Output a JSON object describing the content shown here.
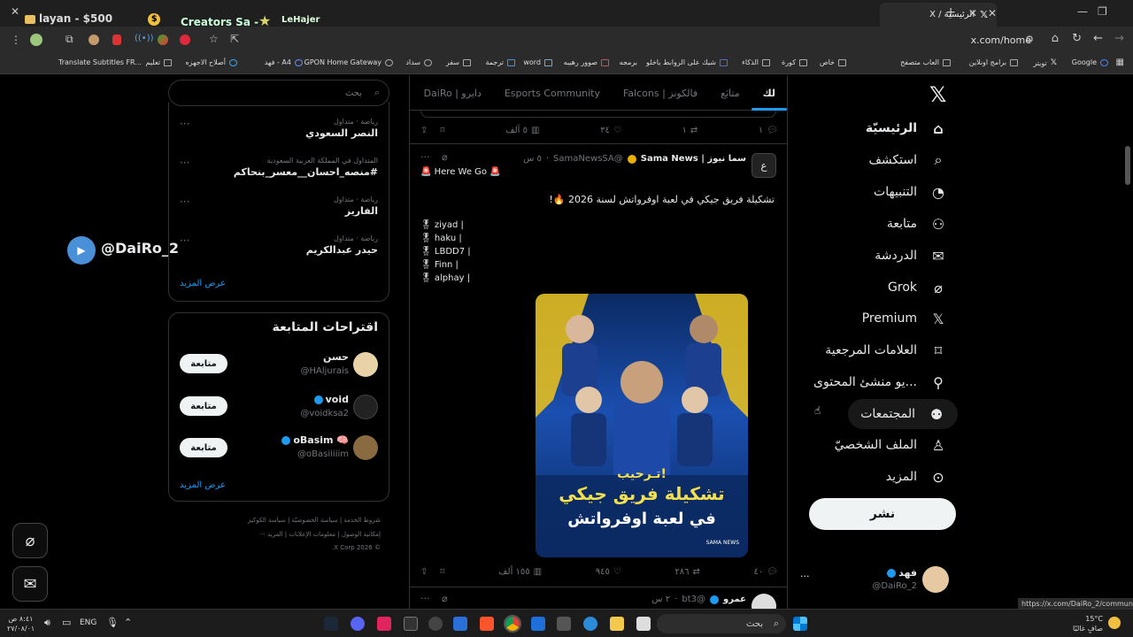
{
  "browser": {
    "tab_title": "الرئيسية / X",
    "url": "x.com/home",
    "overlay_text": "layan - $500",
    "overlay_text2": "Creators Sa -",
    "overlay_text3": "LeHajer",
    "bookmarks": [
      {
        "label": "Google",
        "icon": "google-icon"
      },
      {
        "label": "تويتر",
        "icon": "x-icon"
      },
      {
        "label": "برامج اونلاين",
        "icon": "folder-icon"
      },
      {
        "label": "العاب متصفح",
        "icon": "folder-icon"
      },
      {
        "label": "خاص",
        "icon": "folder-icon"
      },
      {
        "label": "كورة",
        "icon": "folder-icon"
      },
      {
        "label": "الذكاء",
        "icon": "folder-icon"
      },
      {
        "label": "شيك على الروابط ياخلو",
        "icon": "site-icon"
      },
      {
        "label": "برمجه",
        "icon": "site-icon"
      },
      {
        "label": "صوور رهيبه",
        "icon": "site-icon"
      },
      {
        "label": "word",
        "icon": "word-icon"
      },
      {
        "label": "ترجمة",
        "icon": "translate-icon"
      },
      {
        "label": "سفر",
        "icon": "folder-icon"
      },
      {
        "label": "سداد",
        "icon": "site-icon"
      },
      {
        "label": "GPON Home Gateway",
        "icon": "globe-icon"
      },
      {
        "label": "فهد - A4",
        "icon": "site-icon"
      },
      {
        "label": "أصلاح الاجهزه",
        "icon": "site-icon"
      },
      {
        "label": "تعليم",
        "icon": "folder-icon"
      },
      {
        "label": "Translate Subtitles FR...",
        "icon": "site-icon"
      }
    ]
  },
  "nav": {
    "items": [
      {
        "label": "الرئيسيّة",
        "icon": "home-icon"
      },
      {
        "label": "استكشف",
        "icon": "search-icon"
      },
      {
        "label": "التنبيهات",
        "icon": "bell-icon"
      },
      {
        "label": "متابعة",
        "icon": "person-plus-icon"
      },
      {
        "label": "الدردشة",
        "icon": "mail-icon"
      },
      {
        "label": "Grok",
        "icon": "grok-icon"
      },
      {
        "label": "Premium",
        "icon": "x-icon"
      },
      {
        "label": "العلامات المرجعية",
        "icon": "bookmark-icon"
      },
      {
        "label": "...يو منشئ المحتوى",
        "icon": "creator-icon"
      },
      {
        "label": "المجتمعات",
        "icon": "communities-icon"
      },
      {
        "label": "الملف الشخصيّ",
        "icon": "person-icon"
      },
      {
        "label": "المزيد",
        "icon": "more-icon"
      }
    ],
    "post_button": "نشر",
    "profile": {
      "name": "فهد",
      "handle": "@DaiRo_2"
    }
  },
  "timeline": {
    "tabs": [
      "لك",
      "متابَع",
      "فالكونز | Falcons",
      "Esports Community",
      "دايرو | DaiRo"
    ],
    "first_actions": {
      "replies": "١",
      "reposts": "١",
      "likes": "٣٤",
      "views": "٥ آلف"
    },
    "tweet": {
      "author_name": "سما نيوز | Sama News",
      "author_handle": "@SamaNewsSA",
      "time": "٥ س",
      "line1": "🚨 Here We Go 🚨",
      "line2": "تشكيلة فريق جيكي في لعبة اوفرواتش لسنة 2026 🔥!",
      "roster": [
        "ziyad |",
        "haku |",
        "LBDD7 |",
        "Finn |",
        "alphay |"
      ],
      "image_caption_top": "تـرحيب!",
      "image_caption_main": "تشكيلة فريق جيكي",
      "image_caption_sub": "في لعبة اوفرواتش",
      "image_logo": "SAMA NEWS",
      "replies": "٤٠",
      "reposts": "٢٨٦",
      "likes": "٩٤٥",
      "views": "١٥٥ ألف"
    },
    "next_tweet": {
      "author_name": "عمرو",
      "author_handle": "@bt3",
      "time": "٢ س"
    }
  },
  "sidebar": {
    "search_placeholder": "بحث",
    "trends": [
      {
        "meta": "رياضة · متداول",
        "name": "النصر السعودي"
      },
      {
        "meta": "المتداول في المملكة العربية السعودية",
        "name": "#منصه_احسان__معسر_بنحاكم"
      },
      {
        "meta": "رياضة · متداول",
        "name": "الفاريز"
      },
      {
        "meta": "رياضة · متداول",
        "name": "حيدر عبدالكريم"
      }
    ],
    "show_more": "عرض المزيد",
    "suggestions_title": "اقتراحات المتابعة",
    "suggestions": [
      {
        "name": "حسن",
        "handle": "@HAljurais",
        "button": "متابعة"
      },
      {
        "name": "void",
        "handle": "@voidksa2",
        "button": "متابعة"
      },
      {
        "name": "oBasim 🧠",
        "handle": "@oBasiiiiim",
        "button": "متابعة"
      }
    ],
    "suggestions_more": "عرض المزيد",
    "footer_line1": [
      "شروط الخدمة",
      "سياسة الخصوصيّة",
      "سياسة الكوكيز"
    ],
    "footer_line2": [
      "إمكانية الوصول",
      "معلومات الإعلانات",
      "المزيد ···"
    ],
    "footer_line3": "© 2026 X Corp."
  },
  "floating": {
    "username_badge": "@DaiRo_2"
  },
  "status_url": "https://x.com/DaiRo_2/communities",
  "taskbar": {
    "search": "بحث",
    "lang": "ENG",
    "time": "٨:٤١ ص",
    "date": "٢٧/٠٨/٠١",
    "weather_temp": "15°C",
    "weather_desc": "صافٍ غالبًا"
  },
  "colors": {
    "accent": "#1d9bf0",
    "background": "#000000",
    "border": "#2f3336",
    "muted": "#71767b"
  }
}
